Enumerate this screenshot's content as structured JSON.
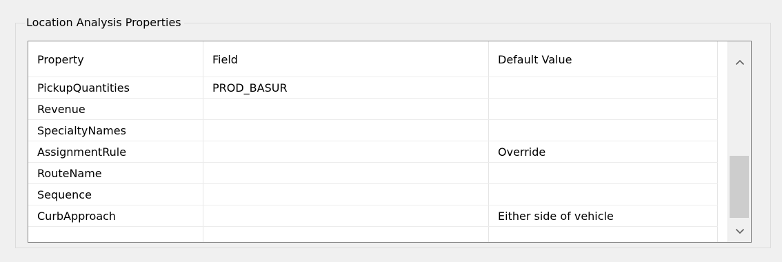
{
  "groupbox": {
    "title": "Location Analysis Properties"
  },
  "table": {
    "columns": [
      "Property",
      "Field",
      "Default Value"
    ],
    "rows": [
      {
        "property": "PickupQuantities",
        "field": "PROD_BASUR",
        "default_value": ""
      },
      {
        "property": "Revenue",
        "field": "",
        "default_value": ""
      },
      {
        "property": "SpecialtyNames",
        "field": "",
        "default_value": ""
      },
      {
        "property": "AssignmentRule",
        "field": "",
        "default_value": "Override"
      },
      {
        "property": "RouteName",
        "field": "",
        "default_value": ""
      },
      {
        "property": "Sequence",
        "field": "",
        "default_value": ""
      },
      {
        "property": "CurbApproach",
        "field": "",
        "default_value": "Either side of vehicle"
      },
      {
        "property": "",
        "field": "",
        "default_value": ""
      }
    ]
  },
  "scrollbar": {
    "up_icon": "chevron-up-icon",
    "down_icon": "chevron-down-icon",
    "position": 0.9
  }
}
